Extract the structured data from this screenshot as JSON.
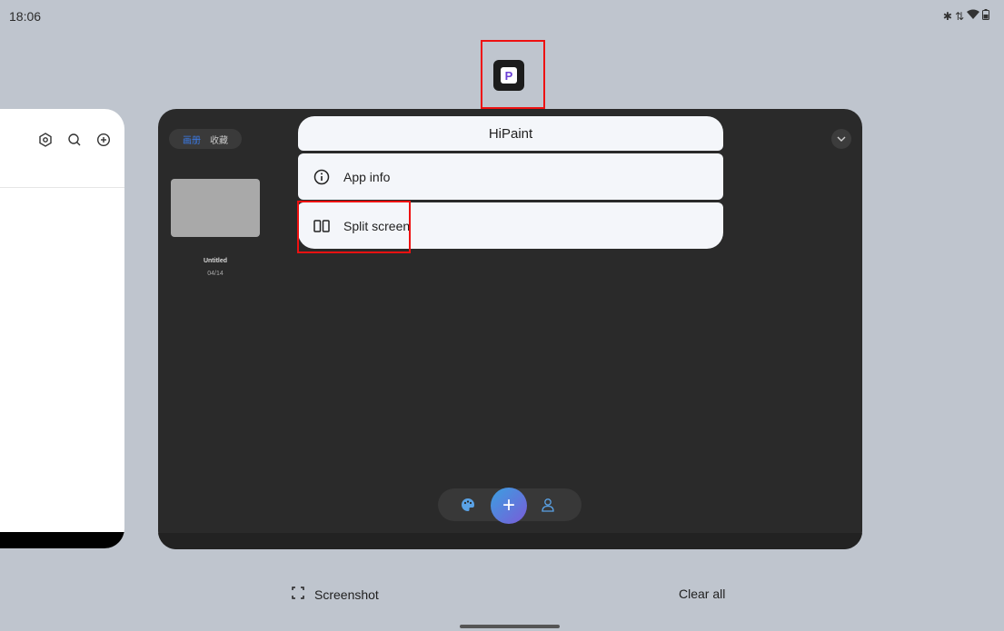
{
  "status_bar": {
    "time": "18:06",
    "icons": [
      "bluetooth-icon",
      "data-arrows-icon",
      "wifi-icon",
      "battery-icon"
    ]
  },
  "app": {
    "name": "HiPaint",
    "icon_letter": "P"
  },
  "menu": {
    "title": "HiPaint",
    "items": [
      {
        "label": "App info",
        "icon": "info-icon"
      },
      {
        "label": "Split screen",
        "icon": "split-screen-icon"
      }
    ]
  },
  "hipaint_preview": {
    "tabs": [
      {
        "label": "画册",
        "active": true
      },
      {
        "label": "收藏",
        "active": false
      }
    ],
    "artwork": {
      "title": "Untitled",
      "date": "04/14"
    },
    "nav": [
      "palette-icon",
      "add-icon",
      "user-icon"
    ]
  },
  "left_card": {
    "toolbar_icons": [
      "settings-icon",
      "search-icon",
      "add-circle-icon"
    ]
  },
  "actions": {
    "screenshot_label": "Screenshot",
    "clear_all_label": "Clear all"
  },
  "colors": {
    "background": "#bfc5ce",
    "menu_background": "#f4f6fa",
    "dark_card": "#2a2a2a",
    "accent_blue": "#3b7be8",
    "highlight_red": "#ee1111"
  }
}
